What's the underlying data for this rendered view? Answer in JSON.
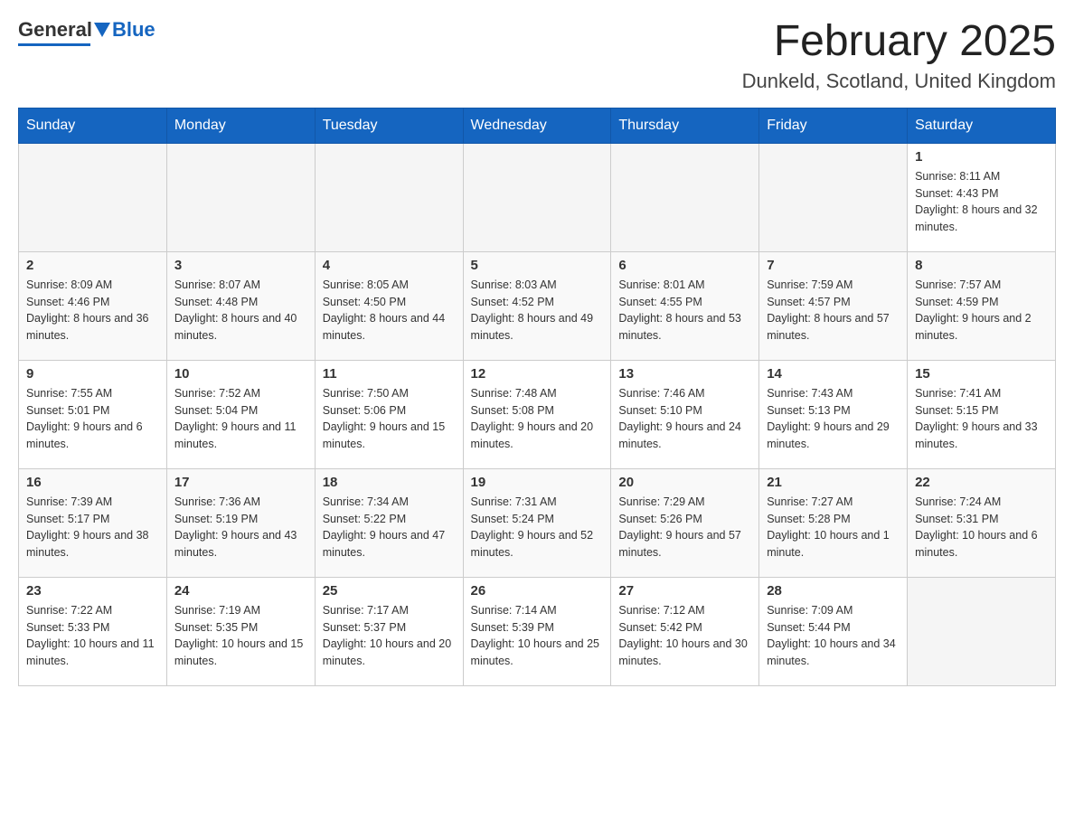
{
  "header": {
    "logo_general": "General",
    "logo_blue": "Blue",
    "month_title": "February 2025",
    "location": "Dunkeld, Scotland, United Kingdom"
  },
  "weekdays": [
    "Sunday",
    "Monday",
    "Tuesday",
    "Wednesday",
    "Thursday",
    "Friday",
    "Saturday"
  ],
  "weeks": [
    [
      {
        "day": "",
        "sunrise": "",
        "sunset": "",
        "daylight": ""
      },
      {
        "day": "",
        "sunrise": "",
        "sunset": "",
        "daylight": ""
      },
      {
        "day": "",
        "sunrise": "",
        "sunset": "",
        "daylight": ""
      },
      {
        "day": "",
        "sunrise": "",
        "sunset": "",
        "daylight": ""
      },
      {
        "day": "",
        "sunrise": "",
        "sunset": "",
        "daylight": ""
      },
      {
        "day": "",
        "sunrise": "",
        "sunset": "",
        "daylight": ""
      },
      {
        "day": "1",
        "sunrise": "Sunrise: 8:11 AM",
        "sunset": "Sunset: 4:43 PM",
        "daylight": "Daylight: 8 hours and 32 minutes."
      }
    ],
    [
      {
        "day": "2",
        "sunrise": "Sunrise: 8:09 AM",
        "sunset": "Sunset: 4:46 PM",
        "daylight": "Daylight: 8 hours and 36 minutes."
      },
      {
        "day": "3",
        "sunrise": "Sunrise: 8:07 AM",
        "sunset": "Sunset: 4:48 PM",
        "daylight": "Daylight: 8 hours and 40 minutes."
      },
      {
        "day": "4",
        "sunrise": "Sunrise: 8:05 AM",
        "sunset": "Sunset: 4:50 PM",
        "daylight": "Daylight: 8 hours and 44 minutes."
      },
      {
        "day": "5",
        "sunrise": "Sunrise: 8:03 AM",
        "sunset": "Sunset: 4:52 PM",
        "daylight": "Daylight: 8 hours and 49 minutes."
      },
      {
        "day": "6",
        "sunrise": "Sunrise: 8:01 AM",
        "sunset": "Sunset: 4:55 PM",
        "daylight": "Daylight: 8 hours and 53 minutes."
      },
      {
        "day": "7",
        "sunrise": "Sunrise: 7:59 AM",
        "sunset": "Sunset: 4:57 PM",
        "daylight": "Daylight: 8 hours and 57 minutes."
      },
      {
        "day": "8",
        "sunrise": "Sunrise: 7:57 AM",
        "sunset": "Sunset: 4:59 PM",
        "daylight": "Daylight: 9 hours and 2 minutes."
      }
    ],
    [
      {
        "day": "9",
        "sunrise": "Sunrise: 7:55 AM",
        "sunset": "Sunset: 5:01 PM",
        "daylight": "Daylight: 9 hours and 6 minutes."
      },
      {
        "day": "10",
        "sunrise": "Sunrise: 7:52 AM",
        "sunset": "Sunset: 5:04 PM",
        "daylight": "Daylight: 9 hours and 11 minutes."
      },
      {
        "day": "11",
        "sunrise": "Sunrise: 7:50 AM",
        "sunset": "Sunset: 5:06 PM",
        "daylight": "Daylight: 9 hours and 15 minutes."
      },
      {
        "day": "12",
        "sunrise": "Sunrise: 7:48 AM",
        "sunset": "Sunset: 5:08 PM",
        "daylight": "Daylight: 9 hours and 20 minutes."
      },
      {
        "day": "13",
        "sunrise": "Sunrise: 7:46 AM",
        "sunset": "Sunset: 5:10 PM",
        "daylight": "Daylight: 9 hours and 24 minutes."
      },
      {
        "day": "14",
        "sunrise": "Sunrise: 7:43 AM",
        "sunset": "Sunset: 5:13 PM",
        "daylight": "Daylight: 9 hours and 29 minutes."
      },
      {
        "day": "15",
        "sunrise": "Sunrise: 7:41 AM",
        "sunset": "Sunset: 5:15 PM",
        "daylight": "Daylight: 9 hours and 33 minutes."
      }
    ],
    [
      {
        "day": "16",
        "sunrise": "Sunrise: 7:39 AM",
        "sunset": "Sunset: 5:17 PM",
        "daylight": "Daylight: 9 hours and 38 minutes."
      },
      {
        "day": "17",
        "sunrise": "Sunrise: 7:36 AM",
        "sunset": "Sunset: 5:19 PM",
        "daylight": "Daylight: 9 hours and 43 minutes."
      },
      {
        "day": "18",
        "sunrise": "Sunrise: 7:34 AM",
        "sunset": "Sunset: 5:22 PM",
        "daylight": "Daylight: 9 hours and 47 minutes."
      },
      {
        "day": "19",
        "sunrise": "Sunrise: 7:31 AM",
        "sunset": "Sunset: 5:24 PM",
        "daylight": "Daylight: 9 hours and 52 minutes."
      },
      {
        "day": "20",
        "sunrise": "Sunrise: 7:29 AM",
        "sunset": "Sunset: 5:26 PM",
        "daylight": "Daylight: 9 hours and 57 minutes."
      },
      {
        "day": "21",
        "sunrise": "Sunrise: 7:27 AM",
        "sunset": "Sunset: 5:28 PM",
        "daylight": "Daylight: 10 hours and 1 minute."
      },
      {
        "day": "22",
        "sunrise": "Sunrise: 7:24 AM",
        "sunset": "Sunset: 5:31 PM",
        "daylight": "Daylight: 10 hours and 6 minutes."
      }
    ],
    [
      {
        "day": "23",
        "sunrise": "Sunrise: 7:22 AM",
        "sunset": "Sunset: 5:33 PM",
        "daylight": "Daylight: 10 hours and 11 minutes."
      },
      {
        "day": "24",
        "sunrise": "Sunrise: 7:19 AM",
        "sunset": "Sunset: 5:35 PM",
        "daylight": "Daylight: 10 hours and 15 minutes."
      },
      {
        "day": "25",
        "sunrise": "Sunrise: 7:17 AM",
        "sunset": "Sunset: 5:37 PM",
        "daylight": "Daylight: 10 hours and 20 minutes."
      },
      {
        "day": "26",
        "sunrise": "Sunrise: 7:14 AM",
        "sunset": "Sunset: 5:39 PM",
        "daylight": "Daylight: 10 hours and 25 minutes."
      },
      {
        "day": "27",
        "sunrise": "Sunrise: 7:12 AM",
        "sunset": "Sunset: 5:42 PM",
        "daylight": "Daylight: 10 hours and 30 minutes."
      },
      {
        "day": "28",
        "sunrise": "Sunrise: 7:09 AM",
        "sunset": "Sunset: 5:44 PM",
        "daylight": "Daylight: 10 hours and 34 minutes."
      },
      {
        "day": "",
        "sunrise": "",
        "sunset": "",
        "daylight": ""
      }
    ]
  ]
}
